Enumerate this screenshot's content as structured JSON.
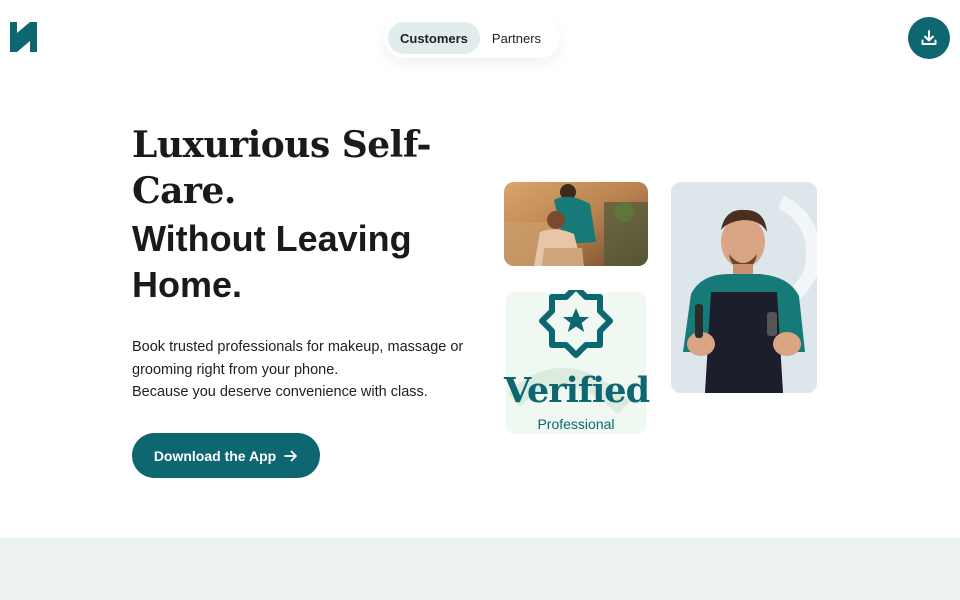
{
  "brand": {
    "logo_icon": "h-logo-icon",
    "accent": "#0d6670"
  },
  "nav": {
    "tabs": [
      {
        "label": "Customers",
        "active": true
      },
      {
        "label": "Partners",
        "active": false
      }
    ],
    "download_icon": "download-icon"
  },
  "hero": {
    "headline_line1": "Luxurious Self-Care.",
    "headline_line2": "Without Leaving Home.",
    "sub_lines": [
      "Book trusted professionals for makeup, massage or grooming right from your phone.",
      "Because you deserve convenience with class."
    ],
    "cta_label": "Download the App",
    "cta_icon": "arrow-right-icon"
  },
  "badge": {
    "title": "Verified",
    "subtitle": "Professional",
    "icon": "star-badge-icon"
  },
  "images": {
    "massage": "massage-photo",
    "barber": "barber-photo"
  },
  "colors": {
    "band": "#ebf2f1",
    "tab_active_bg": "#e1ecec"
  }
}
